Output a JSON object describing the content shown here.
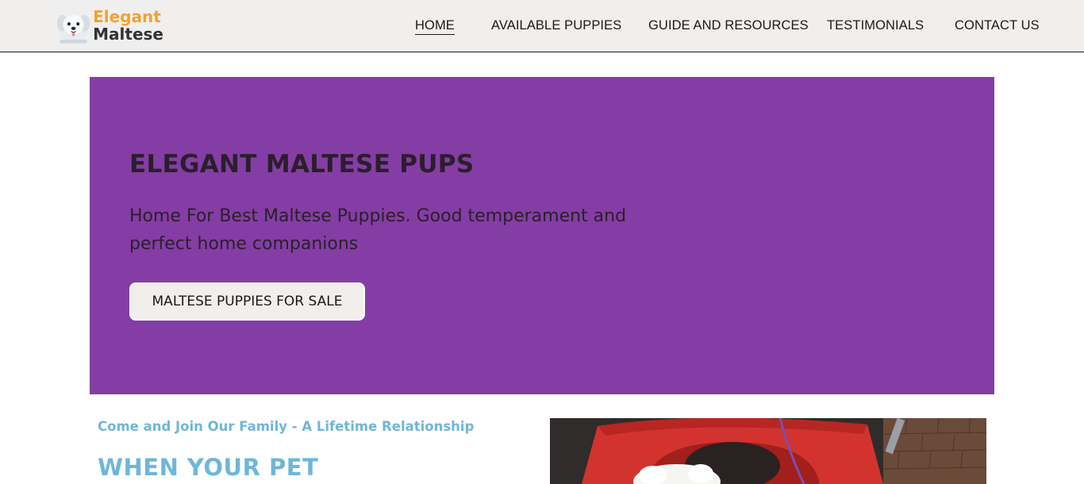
{
  "header": {
    "logo": {
      "line1": "Elegant",
      "line2": "Maltese",
      "icon": "maltese-dog-icon"
    },
    "nav": [
      {
        "label": "HOME",
        "active": true
      },
      {
        "label": "AVAILABLE PUPPIES",
        "active": false
      },
      {
        "label": "GUIDE AND RESOURCES",
        "active": false
      },
      {
        "label": "TESTIMONIALS",
        "active": false
      },
      {
        "label": "CONTACT US",
        "active": false
      }
    ]
  },
  "hero": {
    "title": "ELEGANT MALTESE PUPS",
    "subtitle": "Home For Best Maltese Puppies. Good temperament and perfect home companions",
    "cta_label": "MALTESE PUPPIES FOR SALE",
    "background_color": "#843da4"
  },
  "intro": {
    "tagline": "Come and Join Our Family - A Lifetime Relationship",
    "heading": "WHEN YOUR PET",
    "accent_color": "#6fb6d8"
  },
  "photo": {
    "subject": "maltese-puppy-in-red-stroller"
  }
}
